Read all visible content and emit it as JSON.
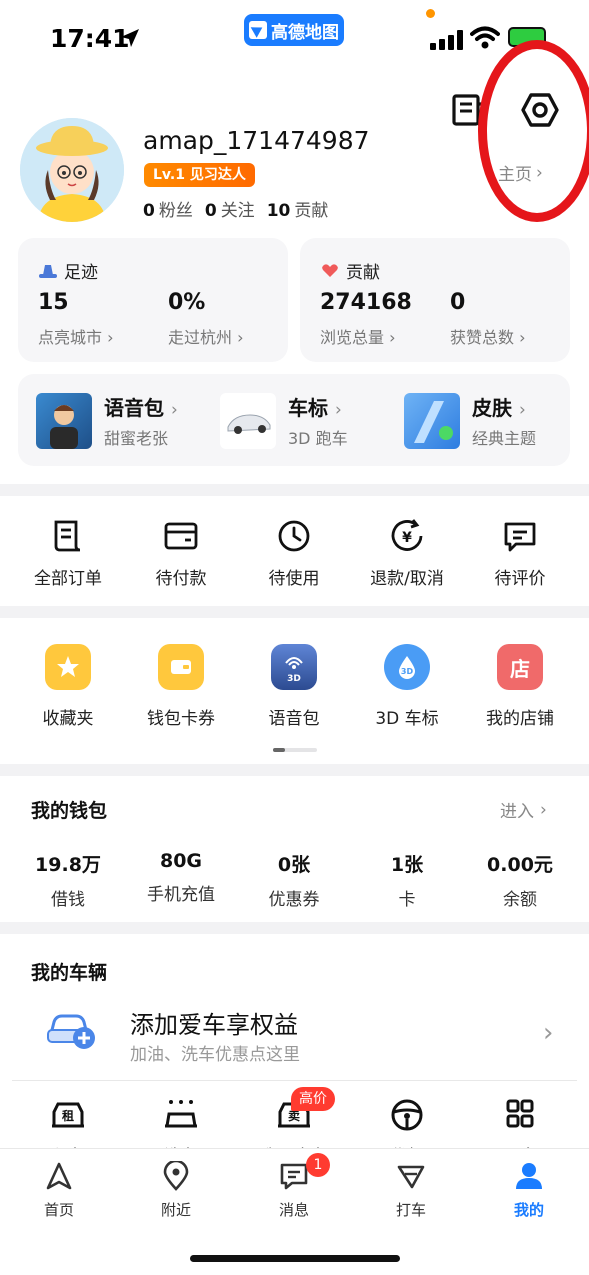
{
  "status_bar": {
    "time": "17:41",
    "app_badge": "高德地图"
  },
  "profile": {
    "username": "amap_171474987",
    "level": "Lv.1 见习达人",
    "fans_count": "0",
    "fans_label": "粉丝",
    "following_count": "0",
    "following_label": "关注",
    "contrib_count": "10",
    "contrib_label": "贡献",
    "homepage_link": "主页"
  },
  "footprint": {
    "title": "足迹",
    "cities_value": "15",
    "cities_label": "点亮城市",
    "visited_value": "0%",
    "visited_label": "走过杭州"
  },
  "contribution": {
    "title": "贡献",
    "views_value": "274168",
    "views_label": "浏览总量",
    "likes_value": "0",
    "likes_label": "获赞总数"
  },
  "features": [
    {
      "title": "语音包",
      "subtitle": "甜蜜老张"
    },
    {
      "title": "车标",
      "subtitle": "3D 跑车"
    },
    {
      "title": "皮肤",
      "subtitle": "经典主题"
    }
  ],
  "orders": [
    {
      "label": "全部订单",
      "icon": "document-icon"
    },
    {
      "label": "待付款",
      "icon": "wallet-icon"
    },
    {
      "label": "待使用",
      "icon": "clock-icon"
    },
    {
      "label": "退款/取消",
      "icon": "refund-icon"
    },
    {
      "label": "待评价",
      "icon": "comment-icon"
    }
  ],
  "tools": [
    {
      "label": "收藏夹",
      "icon": "star-icon",
      "color": "#ffc83d"
    },
    {
      "label": "钱包卡券",
      "icon": "wallet-card-icon",
      "color": "#ffc83d"
    },
    {
      "label": "语音包",
      "icon": "voice-3d-icon",
      "color": "#3b5fa8"
    },
    {
      "label": "3D 车标",
      "icon": "car-3d-icon",
      "color": "#4a9cf5"
    },
    {
      "label": "我的店铺",
      "icon": "shop-icon",
      "color": "#f06a6a",
      "glyph": "店"
    }
  ],
  "wallet": {
    "title": "我的钱包",
    "enter": "进入",
    "items": [
      {
        "value": "19.8万",
        "label": "借钱"
      },
      {
        "value": "80G",
        "label": "手机充值"
      },
      {
        "value": "0张",
        "label": "优惠券"
      },
      {
        "value": "1张",
        "label": "卡"
      },
      {
        "value": "0.00元",
        "label": "余额"
      }
    ]
  },
  "vehicle": {
    "title": "我的车辆",
    "add_title": "添加爱车享权益",
    "add_subtitle": "加油、洗车优惠点这里",
    "quick": [
      {
        "label": "租车",
        "icon": "rent-car-icon",
        "glyph": "租"
      },
      {
        "label": "洗车",
        "icon": "car-wash-icon"
      },
      {
        "label": "我要卖车",
        "icon": "sell-car-icon",
        "glyph": "卖"
      },
      {
        "label": "代驾",
        "icon": "steering-wheel-icon"
      },
      {
        "label": "更多",
        "icon": "grid-icon"
      }
    ],
    "hot_badge": "高价"
  },
  "tabbar": {
    "items": [
      {
        "label": "首页",
        "icon": "navigate-icon"
      },
      {
        "label": "附近",
        "icon": "location-pin-icon"
      },
      {
        "label": "消息",
        "icon": "message-icon"
      },
      {
        "label": "打车",
        "icon": "taxi-icon"
      },
      {
        "label": "我的",
        "icon": "user-icon"
      }
    ],
    "message_badge": "1",
    "active_color": "#1a7cff"
  }
}
